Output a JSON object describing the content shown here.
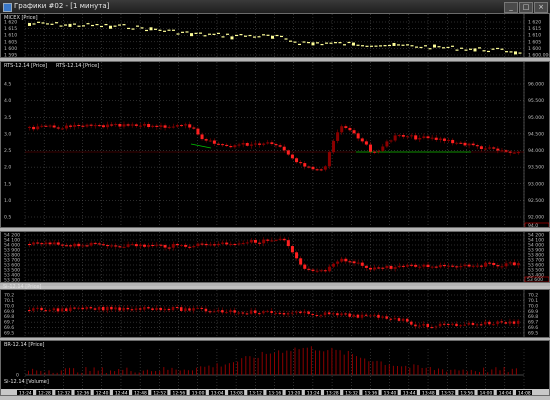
{
  "window": {
    "title": "Графики #02 - [1 минута]",
    "buttons": [
      "_",
      "□",
      "×"
    ]
  },
  "colors": {
    "background": "#000000",
    "grid": "#5a5a5a",
    "candle_up": "#8b0000",
    "candle_down": "#ff2020",
    "micex": "#ffff99",
    "level_green": "#00c000",
    "level_red": "#7a0000"
  },
  "panes": [
    {
      "id": "micex",
      "label": "MICEX [Price]",
      "y_ticks": [
        "1 620",
        "1 615",
        "1 610",
        "1 605",
        "1 600",
        "1 595"
      ],
      "y_ticks_right": [
        "1 620",
        "1 615",
        "1 610",
        "1 605",
        "1 600",
        "1 600.000"
      ]
    },
    {
      "id": "rts",
      "label": "RTS-12.14 [Price]",
      "label2": "RTS-12.14 [Price]",
      "y_ticks": [
        "4.5",
        "4.0",
        "3.5",
        "3.0",
        "2.5",
        "2.0",
        "1.5",
        "1.0",
        "0.5"
      ],
      "y_ticks_right": [
        "96.000",
        "95.500",
        "95.000",
        "94.500",
        "94.000",
        "93.500",
        "93.000",
        "92.500",
        "92.000"
      ],
      "price_box": "94.0"
    },
    {
      "id": "si",
      "label": "Si-12.14 [Price]",
      "y_ticks": [
        "54 200",
        "54 100",
        "54 000",
        "53 900",
        "53 800",
        "53 700",
        "53 600",
        "53 500",
        "53 400",
        "53 300"
      ],
      "y_ticks_right": [
        "54 200",
        "54 100",
        "54 000",
        "53 900",
        "53 800",
        "53 700",
        "53 600",
        "53 500",
        "53 400",
        "53 300"
      ],
      "price_box": "53 600"
    },
    {
      "id": "br",
      "label": "BR-12.14 [Price]",
      "y_ticks": [
        "70.2",
        "70.1",
        "70.0",
        "69.9",
        "69.8",
        "69.7",
        "69.6",
        "69.5"
      ],
      "y_ticks_right": [
        "70.2",
        "70.1",
        "70.0",
        "69.9",
        "69.8",
        "69.7",
        "69.6",
        "69.5"
      ]
    },
    {
      "id": "volume",
      "label": "Si-12.14 [Volume]",
      "y_ticks": [
        "0"
      ]
    }
  ],
  "x_axis_labels": [
    "13:24",
    "12:28",
    "12:32",
    "12:36",
    "12:40",
    "12:44",
    "12:48",
    "12:52",
    "12:56",
    "13:00",
    "13:04",
    "13:08",
    "13:12",
    "13:16",
    "13:20",
    "13:24",
    "13:28",
    "13:32",
    "13:36",
    "13:40",
    "13:44",
    "13:48",
    "13:52",
    "13:56",
    "14:00",
    "14:04",
    "14:08"
  ]
}
